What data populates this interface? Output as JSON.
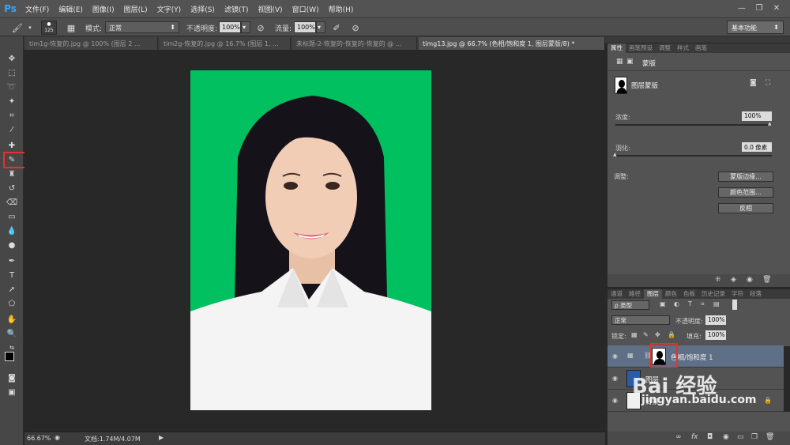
{
  "app": {
    "logo": "Ps"
  },
  "menu": [
    "文件(F)",
    "编辑(E)",
    "图像(I)",
    "图层(L)",
    "文字(Y)",
    "选择(S)",
    "滤镜(T)",
    "视图(V)",
    "窗口(W)",
    "帮助(H)"
  ],
  "window_controls": {
    "minimize": "—",
    "restore": "❐",
    "close": "✕"
  },
  "options": {
    "brush_size": "125",
    "mode_label": "模式:",
    "mode_value": "正常",
    "opacity_label": "不透明度:",
    "opacity_value": "100%",
    "flow_label": "流量:",
    "flow_value": "100%",
    "workspace": "基本功能"
  },
  "tabs": [
    {
      "label": "tim1g-恢复的.jpg @ 100% (图层 2 ...",
      "active": false
    },
    {
      "label": "tim2g-恢复的.jpg @ 16.7% (图层 1, ...",
      "active": false
    },
    {
      "label": "未标题-2-恢复的-恢复的-恢复的 @ ...",
      "active": false
    },
    {
      "label": "timg13.jpg @ 66.7% (色相/饱和度 1, 图层蒙版/8) *",
      "active": true
    }
  ],
  "status": {
    "zoom": "66.67%",
    "doc": "文档:1.74M/4.07M"
  },
  "properties": {
    "tabs": [
      "属性",
      "画笔预设",
      "调整",
      "样式",
      "画笔"
    ],
    "mask_title": "蒙版",
    "layer_mask_label": "图层蒙版",
    "density_label": "浓度:",
    "density_value": "100%",
    "feather_label": "羽化:",
    "feather_value": "0.0 像素",
    "adjust_label": "调整:",
    "btn_mask_edge": "蒙版边缘...",
    "btn_color_range": "颜色范围...",
    "btn_invert": "反相"
  },
  "layers_panel": {
    "tabs": [
      "通道",
      "路径",
      "图层",
      "颜色",
      "色板",
      "历史记录",
      "字符",
      "段落"
    ],
    "filter_label": "ρ 类型",
    "blend_mode": "正常",
    "opacity_label": "不透明度:",
    "opacity_value": "100%",
    "lock_label": "锁定:",
    "fill_label": "填充:",
    "fill_value": "100%",
    "layers": [
      {
        "name": "色相/饱和度 1",
        "selected": true
      },
      {
        "name": "图层",
        "selected": false
      },
      {
        "name": "背景",
        "selected": false
      }
    ],
    "footer_icons": [
      "∞",
      "fx",
      "◘",
      "◉",
      "▭",
      "❐",
      "🗑"
    ]
  },
  "watermark": {
    "brand": "Bai 经验",
    "url": "jingyan.baidu.com"
  },
  "colors": {
    "accent_red": "#e8302a",
    "photo_bg": "#00c060",
    "selected_layer": "#5f6f86"
  }
}
